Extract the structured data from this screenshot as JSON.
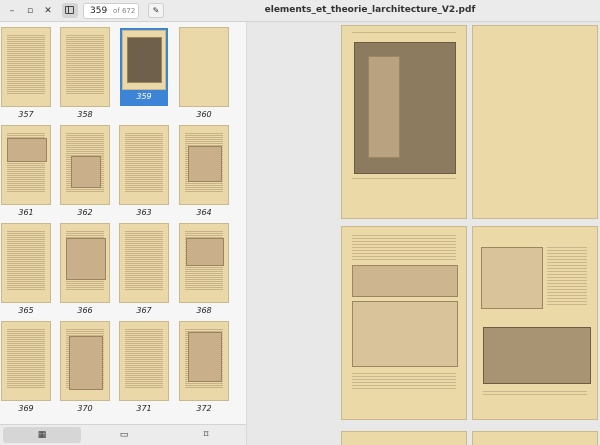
{
  "header": {
    "minimize_glyph": "–",
    "maximize_glyph": "▫",
    "close_glyph": "✕",
    "sidebar_toggle_icon": "sidebar-icon",
    "page_current": "359",
    "page_of": "of 672",
    "edit_icon": "pencil-icon",
    "edit_glyph": "✎",
    "title": "elements_et_theorie_larchitecture_V2.pdf"
  },
  "thumbnails": [
    {
      "label": "357"
    },
    {
      "label": "358"
    },
    {
      "label": "359",
      "selected": true
    },
    {
      "label": "360"
    },
    {
      "label": "361"
    },
    {
      "label": "362"
    },
    {
      "label": "363"
    },
    {
      "label": "364"
    },
    {
      "label": "365"
    },
    {
      "label": "366"
    },
    {
      "label": "367"
    },
    {
      "label": "368"
    },
    {
      "label": "369"
    },
    {
      "label": "370"
    },
    {
      "label": "371"
    },
    {
      "label": "372"
    }
  ],
  "tabs": [
    {
      "icon": "grid-icon",
      "glyph": "▦",
      "active": true
    },
    {
      "icon": "comment-icon",
      "glyph": "▭",
      "active": false
    },
    {
      "icon": "bookmark-icon",
      "glyph": "⌑",
      "active": false
    }
  ],
  "colors": {
    "selection": "#3d83d6",
    "paper": "#ecd9a8"
  }
}
